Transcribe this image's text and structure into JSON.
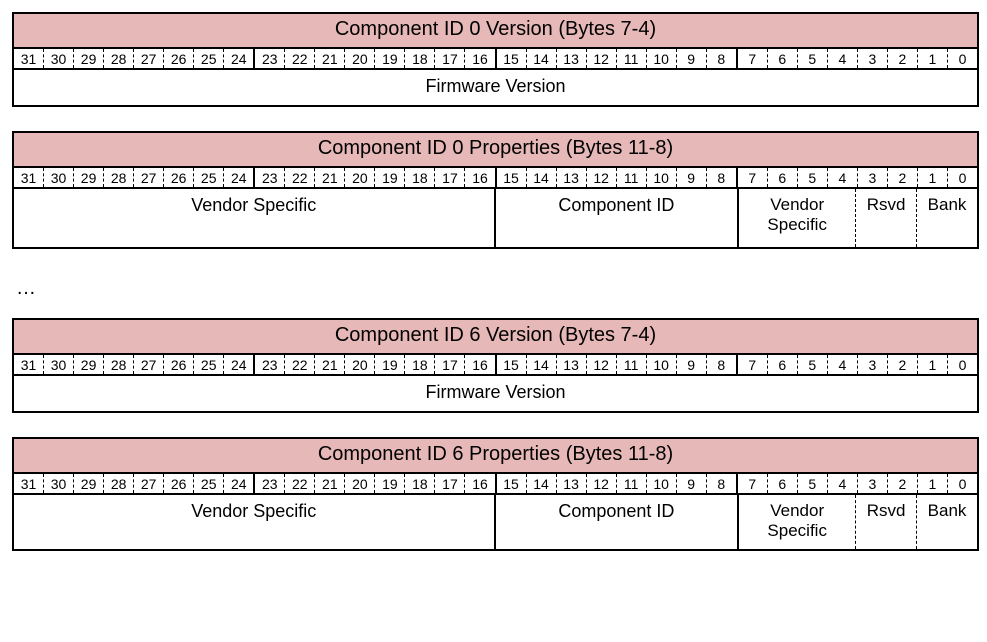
{
  "bit_numbers": [
    "31",
    "30",
    "29",
    "28",
    "27",
    "26",
    "25",
    "24",
    "23",
    "22",
    "21",
    "20",
    "19",
    "18",
    "17",
    "16",
    "15",
    "14",
    "13",
    "12",
    "11",
    "10",
    "9",
    "8",
    "7",
    "6",
    "5",
    "4",
    "3",
    "2",
    "1",
    "0"
  ],
  "ellipsis": "…",
  "labels": {
    "firmware_version": "Firmware Version",
    "vendor_specific_wide": "Vendor Specific",
    "component_id": "Component ID",
    "vendor_specific_narrow": "Vendor Specific",
    "rsvd": "Rsvd",
    "bank": "Bank"
  },
  "blocks": [
    {
      "title": "Component ID 0 Version (Bytes 7-4)",
      "kind": "version",
      "tall": false
    },
    {
      "title": "Component ID 0 Properties (Bytes 11-8)",
      "kind": "properties",
      "tall": true
    },
    {
      "ellipsis": true
    },
    {
      "title": "Component ID 6 Version (Bytes 7-4)",
      "kind": "version",
      "tall": false
    },
    {
      "title": "Component ID 6 Properties (Bytes 11-8)",
      "kind": "properties",
      "tall": false
    }
  ]
}
